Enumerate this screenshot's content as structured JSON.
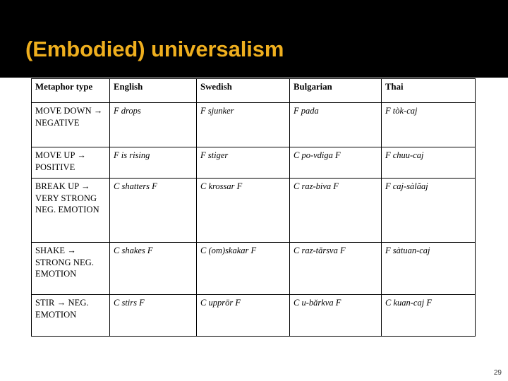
{
  "slide": {
    "title": "(Embodied) universalism",
    "title_color": "#EFAF1E",
    "banner_color": "#000000",
    "background_color": "#FFFFFF",
    "page_number": "29"
  },
  "table": {
    "headers": [
      "Metaphor type",
      "English",
      "Swedish",
      "Bulgarian",
      "Thai"
    ],
    "rows": [
      {
        "type": "MOVE DOWN → NEGATIVE",
        "english": "F drops",
        "swedish": "F sjunker",
        "bulgarian": "F pada",
        "thai": "F tòk-caj"
      },
      {
        "type": "MOVE UP → POSITIVE",
        "english": "F is rising",
        "swedish": "F stiger",
        "bulgarian": "C po-vdiga F",
        "thai": "F chuu-caj"
      },
      {
        "type": "BREAK UP → VERY STRONG NEG. EMOTION",
        "english": "C shatters F",
        "swedish": "C krossar F",
        "bulgarian": "C raz-biva F",
        "thai": "F caj-sàlăaj"
      },
      {
        "type": "SHAKE → STRONG NEG. EMOTION",
        "english": "C shakes F",
        "swedish": "C (om)skakar F",
        "bulgarian": "C raz-tărsva F",
        "thai": "F sàtuan-caj"
      },
      {
        "type": "STIR → NEG. EMOTION",
        "english": "C stirs F",
        "swedish": "C upprör F",
        "bulgarian": "C u-bărkva F",
        "thai": "C kuan-caj F"
      }
    ]
  }
}
